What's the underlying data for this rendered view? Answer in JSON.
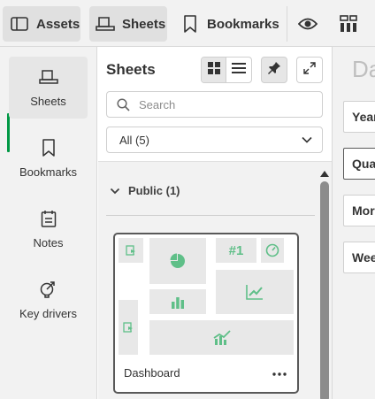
{
  "toolbar": {
    "assets_label": "Assets",
    "sheets_label": "Sheets",
    "bookmarks_label": "Bookmarks"
  },
  "nav": {
    "items": [
      {
        "label": "Sheets",
        "icon": "sheet-icon"
      },
      {
        "label": "Bookmarks",
        "icon": "bookmark-icon"
      },
      {
        "label": "Notes",
        "icon": "notes-icon"
      },
      {
        "label": "Key drivers",
        "icon": "key-drivers-icon"
      }
    ],
    "active": "Sheets"
  },
  "panel": {
    "title": "Sheets",
    "search_placeholder": "Search",
    "filter_value": "All (5)",
    "group_label": "Public (1)",
    "card_title": "Dashboard",
    "thumbnail_kpi": "#1"
  },
  "canvas": {
    "title_partial": "Da",
    "filters": [
      "Year",
      "Qua",
      "Mor",
      "Wee"
    ]
  },
  "colors": {
    "accent": "#009845",
    "chart_green": "#5fbf88",
    "toolbar_bg": "#f2f2f2"
  }
}
